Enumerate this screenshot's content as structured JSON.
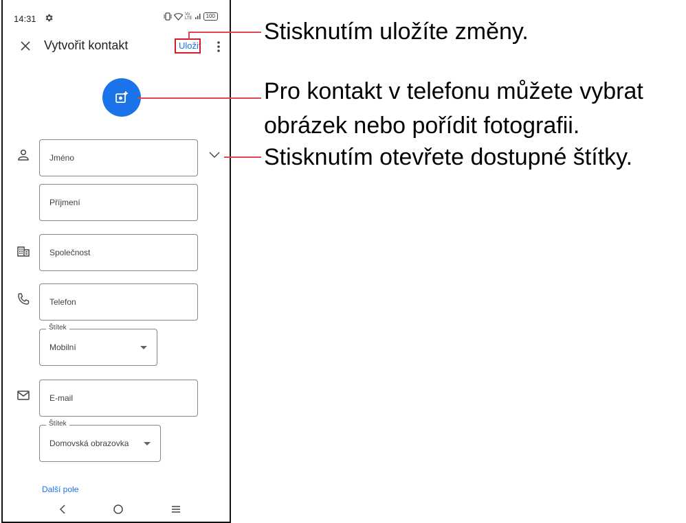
{
  "status_bar": {
    "time": "14:31",
    "battery": "100",
    "icons": [
      "settings-gear-icon",
      "vibrate-icon",
      "wifi-icon",
      "volte-icon",
      "signal-icon",
      "battery-icon"
    ]
  },
  "app_bar": {
    "title": "Vytvořit kontakt",
    "save_label": "Uložit",
    "icons": [
      "close-icon",
      "more-vert-icon"
    ]
  },
  "fab_icon": "add-photo-icon",
  "fields": {
    "first_name": "Jméno",
    "last_name": "Příjmení",
    "company": "Společnost",
    "phone": "Telefon",
    "phone_label_legend": "Štítek",
    "phone_label_value": "Mobilní",
    "email": "E-mail",
    "email_label_legend": "Štítek",
    "email_label_value": "Domovská obrazovka"
  },
  "more_fields_label": "Další pole",
  "callouts": {
    "save": "Stisknutím uložíte změny.",
    "photo_line1": "Pro kontakt v telefonu můžete vybrat",
    "photo_line2": "obrázek nebo pořídit fotografii.",
    "labels": "Stisknutím otevřete dostupné štítky."
  },
  "colors": {
    "accent": "#1a73e8",
    "callout_line": "#e0444c"
  }
}
